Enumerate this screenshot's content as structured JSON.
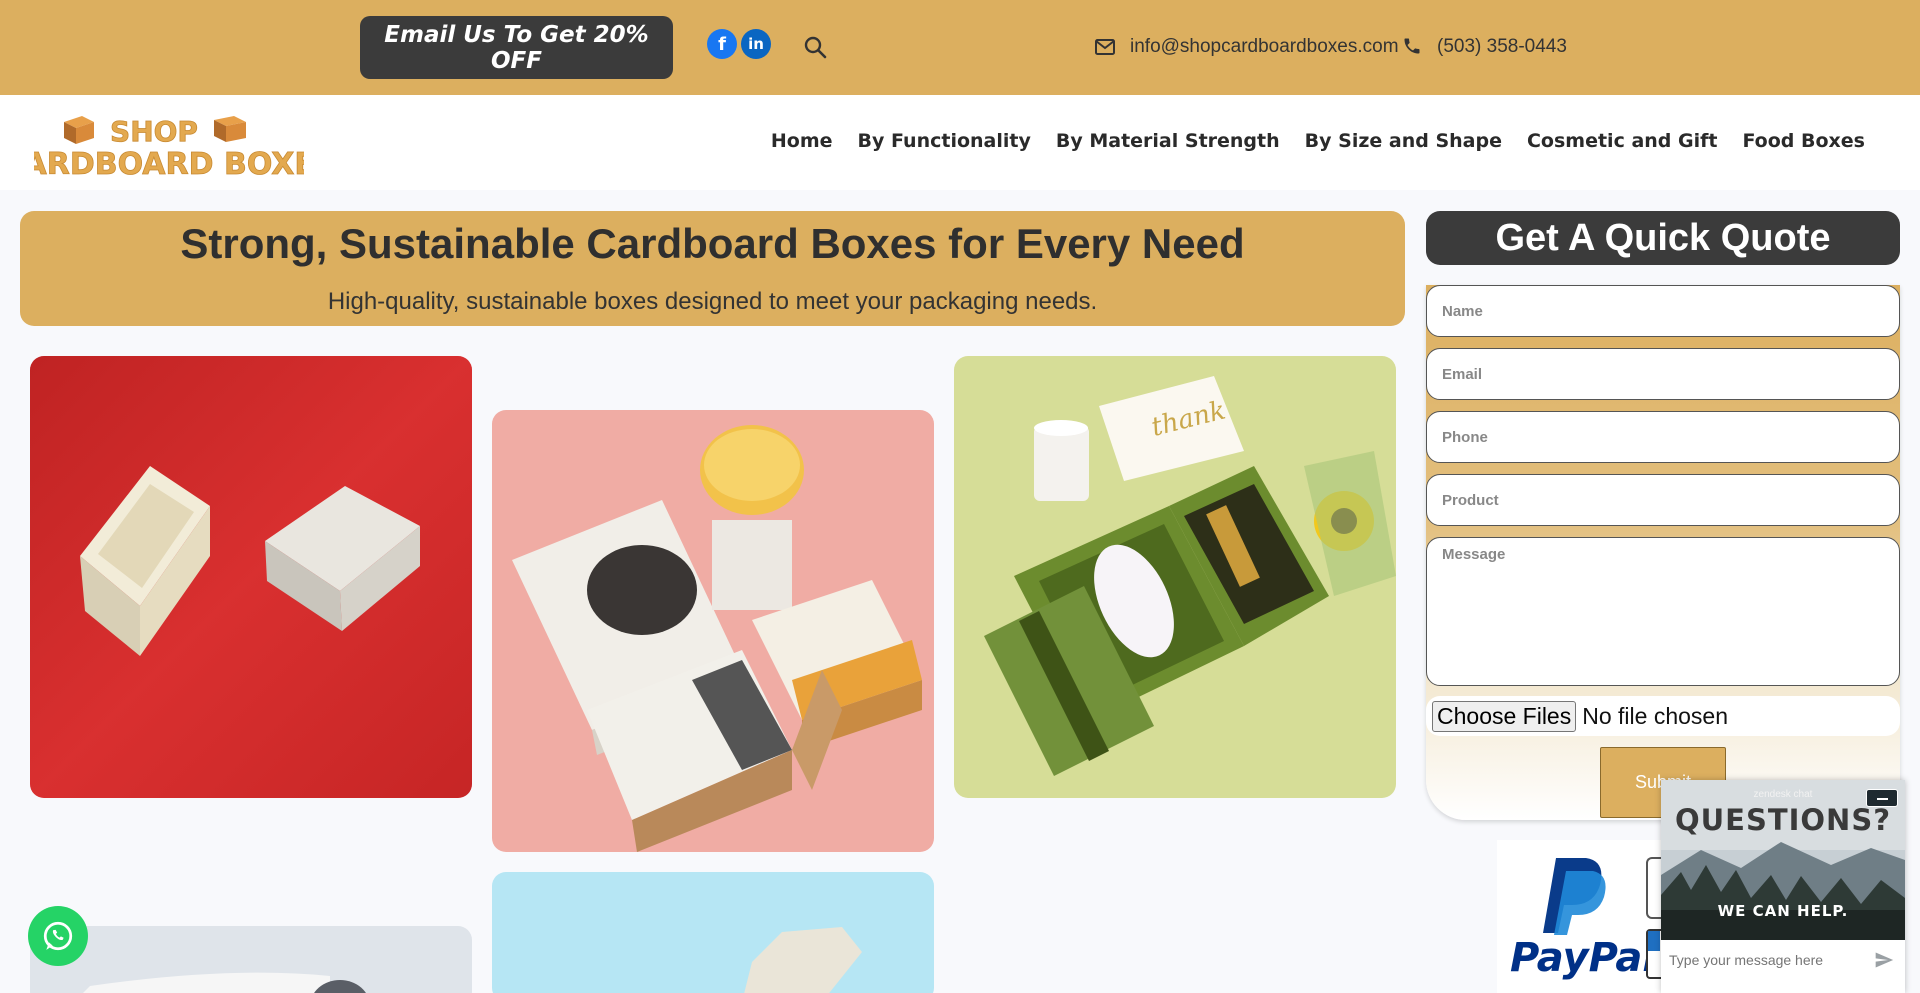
{
  "topbar": {
    "promo_label": "Email Us To Get 20% OFF",
    "facebook_glyph": "f",
    "linkedin_glyph": "in",
    "email": "info@shopcardboardboxes.com",
    "phone": "(503) 358-0443"
  },
  "header": {
    "logo_line1": "SHOP",
    "logo_line2": "CARDBOARD BOXES",
    "nav": [
      "Home",
      "By Functionality",
      "By Material Strength",
      "By Size and Shape",
      "Cosmetic and Gift",
      "Food Boxes"
    ]
  },
  "hero": {
    "title": "Strong, Sustainable Cardboard Boxes for Every Need",
    "subtitle": "High-quality, sustainable boxes designed to meet your packaging needs."
  },
  "quote": {
    "title": "Get A Quick Quote",
    "name_placeholder": "Name",
    "email_placeholder": "Email",
    "phone_placeholder": "Phone",
    "product_placeholder": "Product",
    "message_placeholder": "Message",
    "file_button": "Choose Files",
    "file_status": "No file chosen",
    "submit_label": "Submit"
  },
  "payment": {
    "brand": "PayPal"
  },
  "chat": {
    "provider": "zendesk chat",
    "title": "QUESTIONS?",
    "subtitle": "WE CAN HELP.",
    "input_placeholder": "Type your message here"
  },
  "colors": {
    "brand_gold": "#dcaf5f",
    "dark": "#3b3b3b"
  },
  "icons": [
    "facebook-icon",
    "linkedin-icon",
    "search-icon",
    "mail-icon",
    "phone-icon",
    "whatsapp-icon",
    "send-icon",
    "minimize-icon"
  ]
}
